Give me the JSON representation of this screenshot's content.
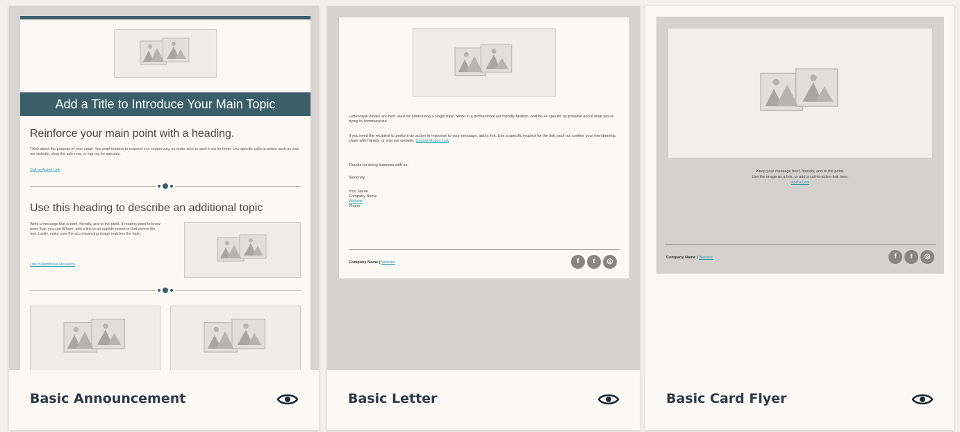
{
  "templates": [
    {
      "name": "Basic Announcement",
      "preview": {
        "title": "Add a Title to Introduce Your Main Topic",
        "heading1": "Reinforce your main point with a heading.",
        "para1": "Think about the purpose of your email. You want readers to respond in a certain way, so make sure to spell it out for them. Use specific calls-to-action such as visit our website, shop the sale now, or sign up for specials.",
        "link1": "Call-to-Action Link",
        "heading2": "Use this heading to describe an additional topic",
        "para2": "Write a message that is brief, friendly, and to the point. If readers need to know more than you can fit here, add a link to an outside resource that covers the rest. Lastly, make sure the accompanying image matches the topic.",
        "link2": "Link to Additional Resource"
      }
    },
    {
      "name": "Basic Letter",
      "preview": {
        "para1": "Letter-style emails are best used for addressing a single topic. Write in a professional yet friendly fashion, and be as specific as possible about what you're trying to communicate.",
        "para2": "If you need the recipient to perform an action in response to your message, add a link. Use a specific request for the link, such as confirm your membership, share with friends, or visit our website.",
        "para2_link": "Custom Action Link",
        "thanks": "Thanks for doing business with us.",
        "closing": "Sincerely,",
        "sig_name": "Your Name",
        "sig_company": "Company Name",
        "sig_website": "Website",
        "sig_phone": "Phone",
        "footer_company": "Company Name",
        "footer_sep": " | ",
        "footer_link": "Website"
      }
    },
    {
      "name": "Basic Card Flyer",
      "preview": {
        "line1": "Keep your message brief, friendly, and to the point.",
        "line2": "Use the image as a link, or add a call-to-action link here.",
        "link": "Add a Link",
        "footer_company": "Company Name",
        "footer_sep": " | ",
        "footer_link": "Website"
      }
    }
  ],
  "icons": {
    "preview": "eye-icon",
    "social": [
      "facebook-icon",
      "twitter-icon",
      "instagram-icon"
    ]
  },
  "colors": {
    "accent": "#3a5f69",
    "link": "#2a9ab0",
    "title_text": "#2d3a44"
  }
}
